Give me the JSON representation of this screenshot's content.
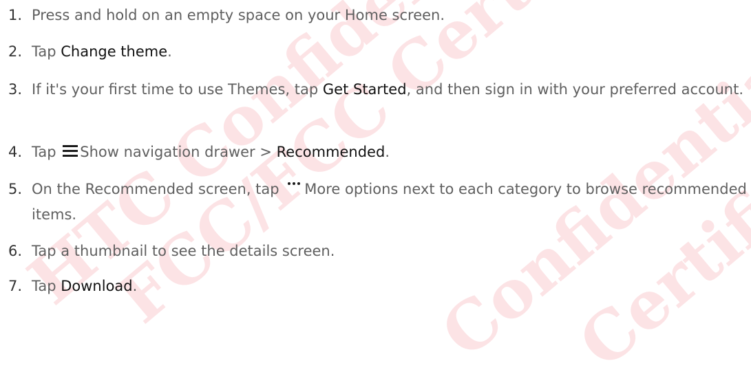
{
  "watermark": {
    "lines": [
      "HTC Confidential",
      "FCC/FCC Certification",
      "Confidential",
      "Certification"
    ],
    "color": "#e82837"
  },
  "steps": [
    {
      "number": "1.",
      "parts": [
        "Press and hold on an empty space on your Home screen."
      ]
    },
    {
      "number": "2.",
      "parts": [
        "Tap ",
        "Change theme",
        "."
      ]
    },
    {
      "number": "3.",
      "parts": [
        "If it's your first time to use Themes, tap ",
        "Get Started",
        ", and then sign in with your preferred account."
      ]
    },
    {
      "number": "4.",
      "icon": "hamburger-menu-icon",
      "parts": [
        "Tap ",
        "Show navigation drawer > ",
        "Recommended",
        "."
      ]
    },
    {
      "number": "5.",
      "icon": "more-options-icon",
      "parts": [
        "On the Recommended screen, tap ",
        "More options next to each category to browse recommended items."
      ]
    },
    {
      "number": "6.",
      "parts": [
        "Tap a thumbnail to see the details screen."
      ]
    },
    {
      "number": "7.",
      "parts": [
        "Tap ",
        "Download",
        "."
      ]
    }
  ]
}
